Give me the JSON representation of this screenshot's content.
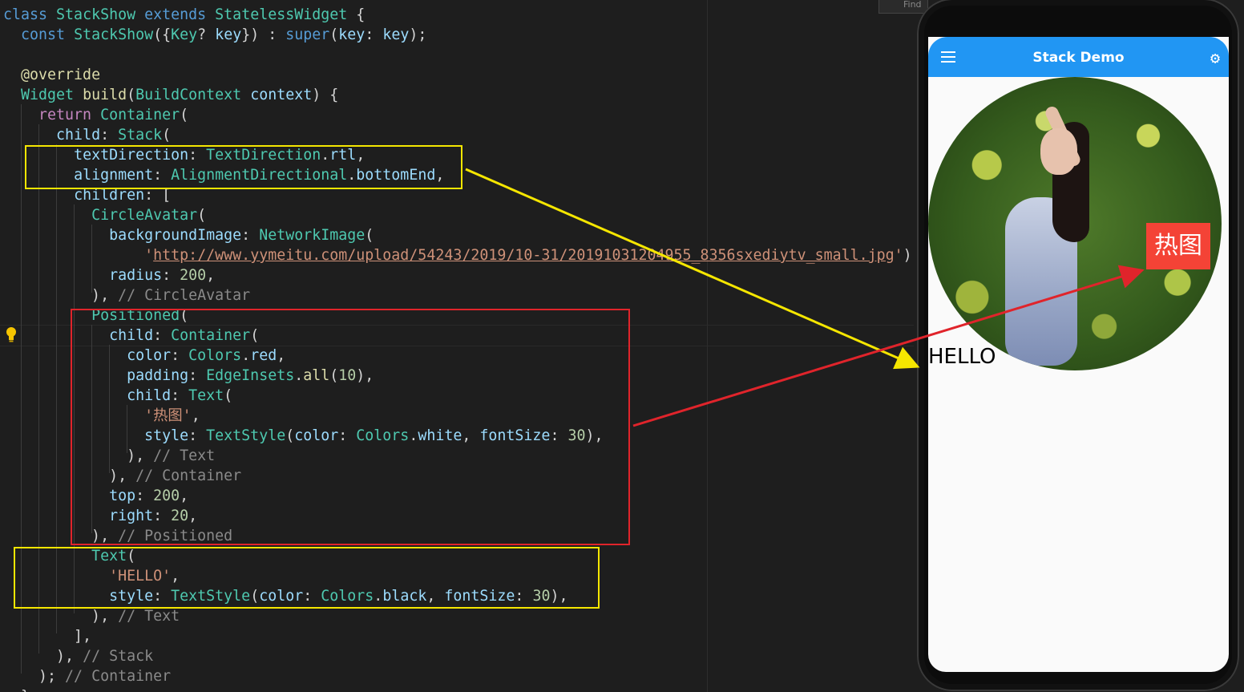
{
  "find_tab": {
    "label": "Find"
  },
  "code": {
    "lines": [
      [
        [
          "kw",
          "class "
        ],
        [
          "ty",
          "StackShow "
        ],
        [
          "kw",
          "extends "
        ],
        [
          "ty",
          "StatelessWidget "
        ],
        [
          "pl",
          "{"
        ]
      ],
      [
        [
          "pl",
          "  "
        ],
        [
          "kw",
          "const "
        ],
        [
          "ty",
          "StackShow"
        ],
        [
          "pl",
          "({"
        ],
        [
          "ty",
          "Key"
        ],
        [
          "pl",
          "? "
        ],
        [
          "pr",
          "key"
        ],
        [
          "pl",
          "}) : "
        ],
        [
          "kw",
          "super"
        ],
        [
          "pl",
          "("
        ],
        [
          "pr",
          "key"
        ],
        [
          "pl",
          ": "
        ],
        [
          "pr",
          "key"
        ],
        [
          "pl",
          ");"
        ]
      ],
      [],
      [
        [
          "pl",
          "  "
        ],
        [
          "an",
          "@override"
        ]
      ],
      [
        [
          "pl",
          "  "
        ],
        [
          "ty",
          "Widget "
        ],
        [
          "fn",
          "build"
        ],
        [
          "pl",
          "("
        ],
        [
          "ty",
          "BuildContext "
        ],
        [
          "pr",
          "context"
        ],
        [
          "pl",
          ") {"
        ]
      ],
      [
        [
          "pl",
          "    "
        ],
        [
          "kw2",
          "return "
        ],
        [
          "ty",
          "Container"
        ],
        [
          "pl",
          "("
        ]
      ],
      [
        [
          "pl",
          "      "
        ],
        [
          "pr",
          "child"
        ],
        [
          "pl",
          ": "
        ],
        [
          "ty",
          "Stack"
        ],
        [
          "pl",
          "("
        ]
      ],
      [
        [
          "pl",
          "        "
        ],
        [
          "pr",
          "textDirection"
        ],
        [
          "pl",
          ": "
        ],
        [
          "ty",
          "TextDirection"
        ],
        [
          "pl",
          "."
        ],
        [
          "pr",
          "rtl"
        ],
        [
          "pl",
          ","
        ]
      ],
      [
        [
          "pl",
          "        "
        ],
        [
          "pr",
          "alignment"
        ],
        [
          "pl",
          ": "
        ],
        [
          "ty",
          "AlignmentDirectional"
        ],
        [
          "pl",
          "."
        ],
        [
          "pr",
          "bottomEnd"
        ],
        [
          "pl",
          ","
        ]
      ],
      [
        [
          "pl",
          "        "
        ],
        [
          "pr",
          "children"
        ],
        [
          "pl",
          ": ["
        ]
      ],
      [
        [
          "pl",
          "          "
        ],
        [
          "ty",
          "CircleAvatar"
        ],
        [
          "pl",
          "("
        ]
      ],
      [
        [
          "pl",
          "            "
        ],
        [
          "pr",
          "backgroundImage"
        ],
        [
          "pl",
          ": "
        ],
        [
          "ty",
          "NetworkImage"
        ],
        [
          "pl",
          "("
        ]
      ],
      [
        [
          "pl",
          "                "
        ],
        [
          "st",
          "'"
        ],
        [
          "url",
          "http://www.yymeitu.com/upload/54243/2019/10-31/20191031204955_8356sxediytv_small.jpg"
        ],
        [
          "st",
          "'"
        ],
        [
          "pl",
          "),"
        ]
      ],
      [
        [
          "pl",
          "            "
        ],
        [
          "pr",
          "radius"
        ],
        [
          "pl",
          ": "
        ],
        [
          "nu",
          "200"
        ],
        [
          "pl",
          ","
        ]
      ],
      [
        [
          "pl",
          "          ), "
        ],
        [
          "cm",
          "// CircleAvatar"
        ]
      ],
      [
        [
          "pl",
          "          "
        ],
        [
          "ty",
          "Positioned"
        ],
        [
          "pl",
          "("
        ]
      ],
      [
        [
          "pl",
          "            "
        ],
        [
          "pr",
          "child"
        ],
        [
          "pl",
          ": "
        ],
        [
          "ty",
          "Container"
        ],
        [
          "pl",
          "("
        ]
      ],
      [
        [
          "pl",
          "              "
        ],
        [
          "pr",
          "color"
        ],
        [
          "pl",
          ": "
        ],
        [
          "ty",
          "Colors"
        ],
        [
          "pl",
          "."
        ],
        [
          "pr",
          "red"
        ],
        [
          "pl",
          ","
        ]
      ],
      [
        [
          "pl",
          "              "
        ],
        [
          "pr",
          "padding"
        ],
        [
          "pl",
          ": "
        ],
        [
          "ty",
          "EdgeInsets"
        ],
        [
          "pl",
          "."
        ],
        [
          "fn",
          "all"
        ],
        [
          "pl",
          "("
        ],
        [
          "nu",
          "10"
        ],
        [
          "pl",
          "),"
        ]
      ],
      [
        [
          "pl",
          "              "
        ],
        [
          "pr",
          "child"
        ],
        [
          "pl",
          ": "
        ],
        [
          "ty",
          "Text"
        ],
        [
          "pl",
          "("
        ]
      ],
      [
        [
          "pl",
          "                "
        ],
        [
          "st",
          "'热图'"
        ],
        [
          "pl",
          ","
        ]
      ],
      [
        [
          "pl",
          "                "
        ],
        [
          "pr",
          "style"
        ],
        [
          "pl",
          ": "
        ],
        [
          "ty",
          "TextStyle"
        ],
        [
          "pl",
          "("
        ],
        [
          "pr",
          "color"
        ],
        [
          "pl",
          ": "
        ],
        [
          "ty",
          "Colors"
        ],
        [
          "pl",
          "."
        ],
        [
          "pr",
          "white"
        ],
        [
          "pl",
          ", "
        ],
        [
          "pr",
          "fontSize"
        ],
        [
          "pl",
          ": "
        ],
        [
          "nu",
          "30"
        ],
        [
          "pl",
          "),"
        ]
      ],
      [
        [
          "pl",
          "              ), "
        ],
        [
          "cm",
          "// Text"
        ]
      ],
      [
        [
          "pl",
          "            ), "
        ],
        [
          "cm",
          "// Container"
        ]
      ],
      [
        [
          "pl",
          "            "
        ],
        [
          "pr",
          "top"
        ],
        [
          "pl",
          ": "
        ],
        [
          "nu",
          "200"
        ],
        [
          "pl",
          ","
        ]
      ],
      [
        [
          "pl",
          "            "
        ],
        [
          "pr",
          "right"
        ],
        [
          "pl",
          ": "
        ],
        [
          "nu",
          "20"
        ],
        [
          "pl",
          ","
        ]
      ],
      [
        [
          "pl",
          "          ), "
        ],
        [
          "cm",
          "// Positioned"
        ]
      ],
      [
        [
          "pl",
          "          "
        ],
        [
          "ty",
          "Text"
        ],
        [
          "pl",
          "("
        ]
      ],
      [
        [
          "pl",
          "            "
        ],
        [
          "st",
          "'HELLO'"
        ],
        [
          "pl",
          ","
        ]
      ],
      [
        [
          "pl",
          "            "
        ],
        [
          "pr",
          "style"
        ],
        [
          "pl",
          ": "
        ],
        [
          "ty",
          "TextStyle"
        ],
        [
          "pl",
          "("
        ],
        [
          "pr",
          "color"
        ],
        [
          "pl",
          ": "
        ],
        [
          "ty",
          "Colors"
        ],
        [
          "pl",
          "."
        ],
        [
          "pr",
          "black"
        ],
        [
          "pl",
          ", "
        ],
        [
          "pr",
          "fontSize"
        ],
        [
          "pl",
          ": "
        ],
        [
          "nu",
          "30"
        ],
        [
          "pl",
          "),"
        ]
      ],
      [
        [
          "pl",
          "          ), "
        ],
        [
          "cm",
          "// Text"
        ]
      ],
      [
        [
          "pl",
          "        ],"
        ]
      ],
      [
        [
          "pl",
          "      ), "
        ],
        [
          "cm",
          "// Stack"
        ]
      ],
      [
        [
          "pl",
          "    ); "
        ],
        [
          "cm",
          "// Container"
        ]
      ],
      [
        [
          "pl",
          "  }"
        ]
      ]
    ]
  },
  "phone": {
    "app_title": "Stack Demo",
    "menu_icon": "menu-icon",
    "settings_icon": "gear-icon",
    "badge_text": "热图",
    "hello_text": "HELLO",
    "appbar_color": "#2196f3",
    "badge_color": "#f44336"
  },
  "annotations": {
    "yellow": "#f5e600",
    "red": "#e0242b"
  }
}
